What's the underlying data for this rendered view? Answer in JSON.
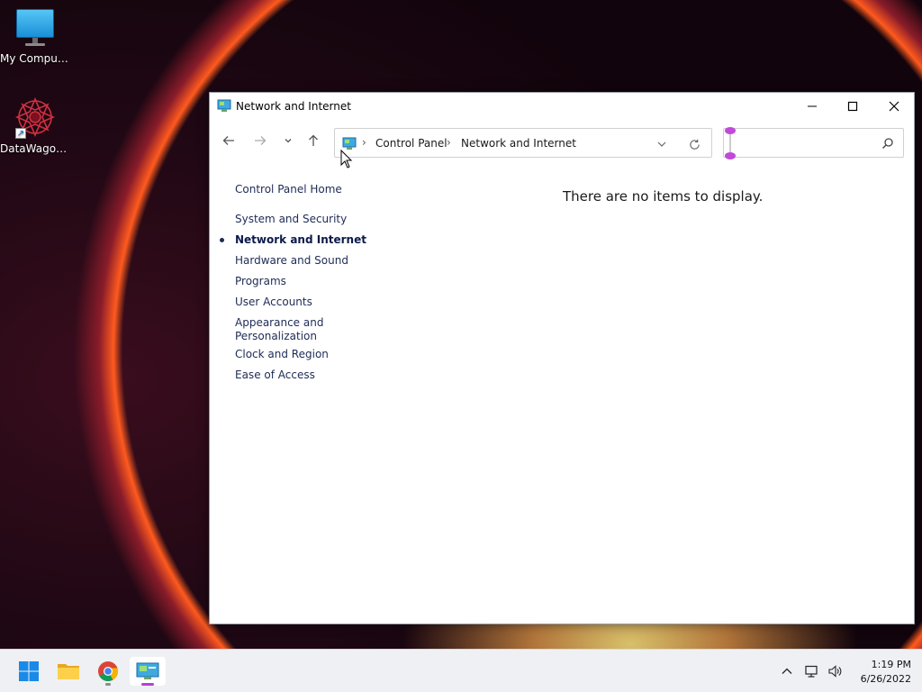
{
  "desktop": {
    "icons": [
      {
        "label": "My Computer",
        "icon": "monitor-icon"
      },
      {
        "label": "DataWagon...",
        "icon": "datawagon-logo-icon"
      }
    ]
  },
  "window": {
    "title": "Network and Internet",
    "address": {
      "crumbs": [
        "Control Panel",
        "Network and Internet"
      ]
    },
    "search": {
      "placeholder": "",
      "value": ""
    },
    "sidebar": {
      "home": "Control Panel Home",
      "items": [
        {
          "label": "System and Security",
          "active": false
        },
        {
          "label": "Network and Internet",
          "active": true
        },
        {
          "label": "Hardware and Sound",
          "active": false
        },
        {
          "label": "Programs",
          "active": false
        },
        {
          "label": "User Accounts",
          "active": false
        },
        {
          "label": "Appearance and\nPersonalization",
          "active": false
        },
        {
          "label": "Clock and Region",
          "active": false
        },
        {
          "label": "Ease of Access",
          "active": false
        }
      ]
    },
    "content": {
      "empty_message": "There are no items to display."
    }
  },
  "taskbar": {
    "apps": [
      {
        "name": "start",
        "icon": "windows-start-icon"
      },
      {
        "name": "file-explorer",
        "icon": "folder-icon"
      },
      {
        "name": "chrome",
        "icon": "chrome-icon"
      },
      {
        "name": "control-panel",
        "icon": "control-panel-icon"
      }
    ],
    "tray": {
      "icons": [
        "chevron-up-icon",
        "network-icon",
        "volume-icon"
      ]
    },
    "clock": {
      "time": "1:19 PM",
      "date": "6/26/2022"
    }
  },
  "colors": {
    "accent": "#b83fd8",
    "link": "#1e2b55"
  }
}
